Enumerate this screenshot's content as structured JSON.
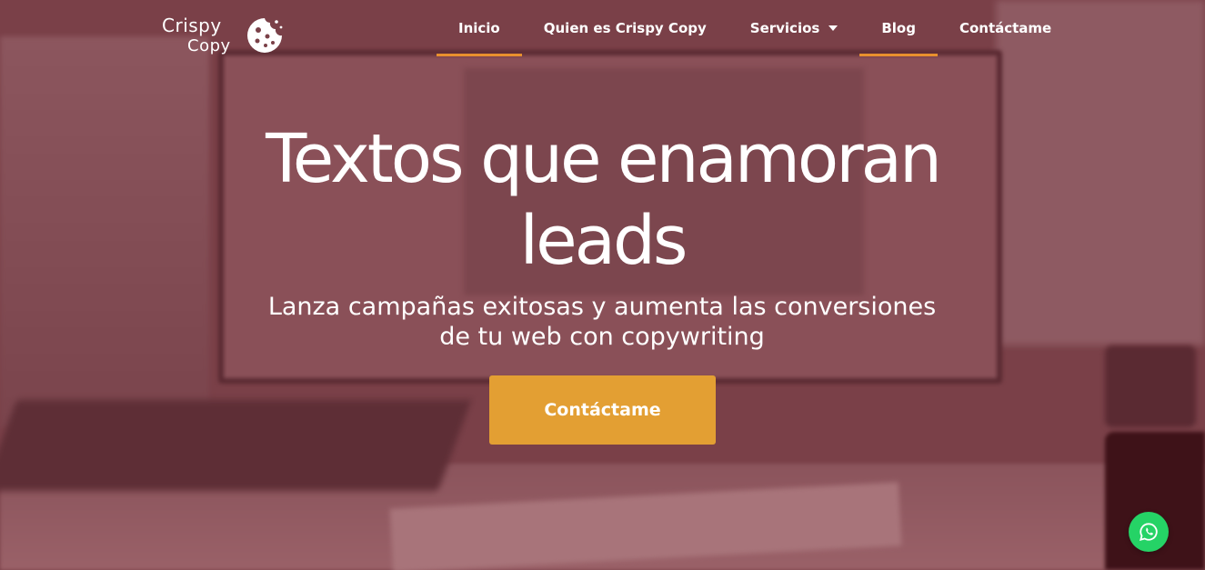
{
  "logo": {
    "line1": "Crispy",
    "line2": "Copy",
    "icon": "cookie-icon"
  },
  "nav": {
    "items": [
      {
        "label": "Inicio",
        "active": true
      },
      {
        "label": "Quien es Crispy Copy",
        "active": false
      },
      {
        "label": "Servicios",
        "active": false,
        "icon": "chevron-down-icon"
      },
      {
        "label": "Blog",
        "active": true
      },
      {
        "label": "Contáctame",
        "active": false
      }
    ]
  },
  "hero": {
    "headline_line1": "Textos que enamoran",
    "headline_line2": "leads",
    "subtitle_line1": "Lanza campañas exitosas y aumenta las conversiones",
    "subtitle_line2": "de tu web con copywriting",
    "cta_label": "Contáctame"
  },
  "floating": {
    "icon": "whatsapp-icon"
  },
  "colors": {
    "overlay": "#7a4048",
    "accent_underline": "#e8902e",
    "cta": "#e39f33",
    "whatsapp": "#25d366"
  }
}
